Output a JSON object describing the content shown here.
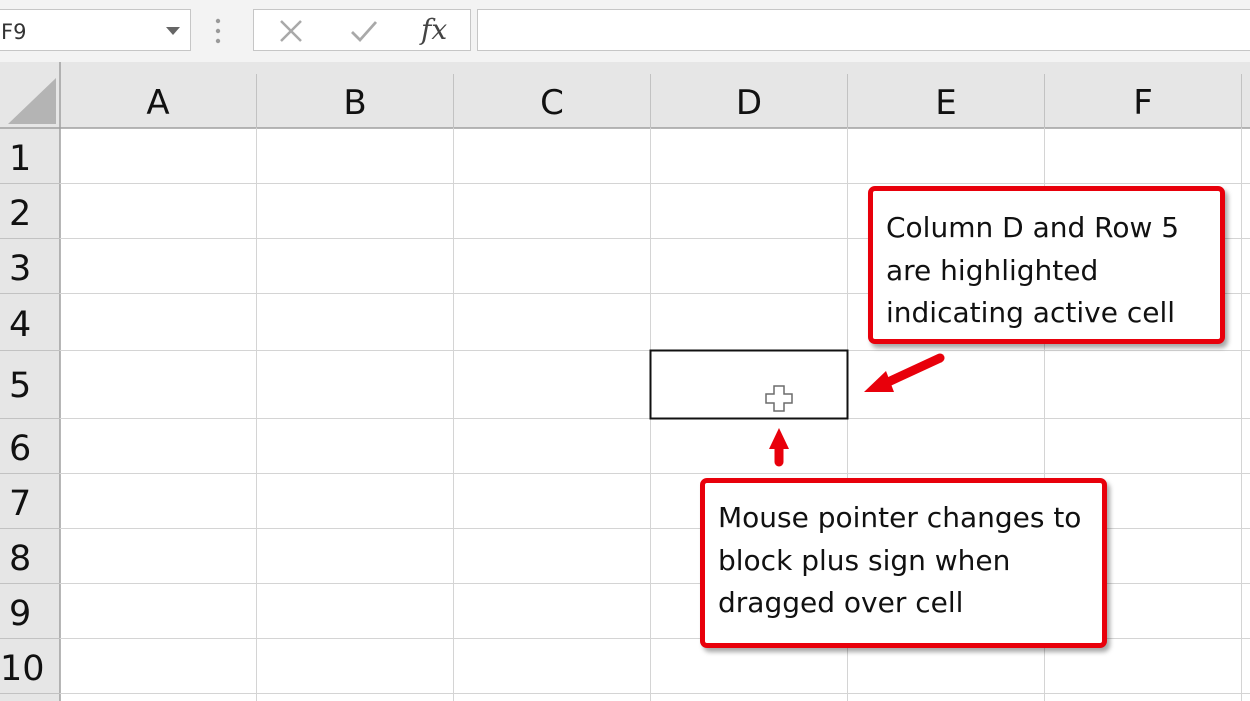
{
  "formula_bar": {
    "name_box_value": "F9",
    "cancel_icon": "close-icon",
    "enter_icon": "check-icon",
    "function_label": "fx",
    "formula_value": ""
  },
  "grid": {
    "columns": [
      "A",
      "B",
      "C",
      "D",
      "E",
      "F"
    ],
    "rows": [
      "1",
      "2",
      "3",
      "4",
      "5",
      "6",
      "7",
      "8",
      "9",
      "10"
    ],
    "active_cell": "D5"
  },
  "callouts": {
    "highlight": {
      "lines": [
        "Column D and Row 5",
        "are highlighted",
        "indicating active cell"
      ]
    },
    "pointer": {
      "lines": [
        "Mouse pointer changes to",
        "block plus sign when",
        "dragged over cell"
      ]
    }
  },
  "colors": {
    "callout_border": "#e8000b",
    "header_background": "#e6e6e6",
    "gridline": "#d4d4d4"
  }
}
